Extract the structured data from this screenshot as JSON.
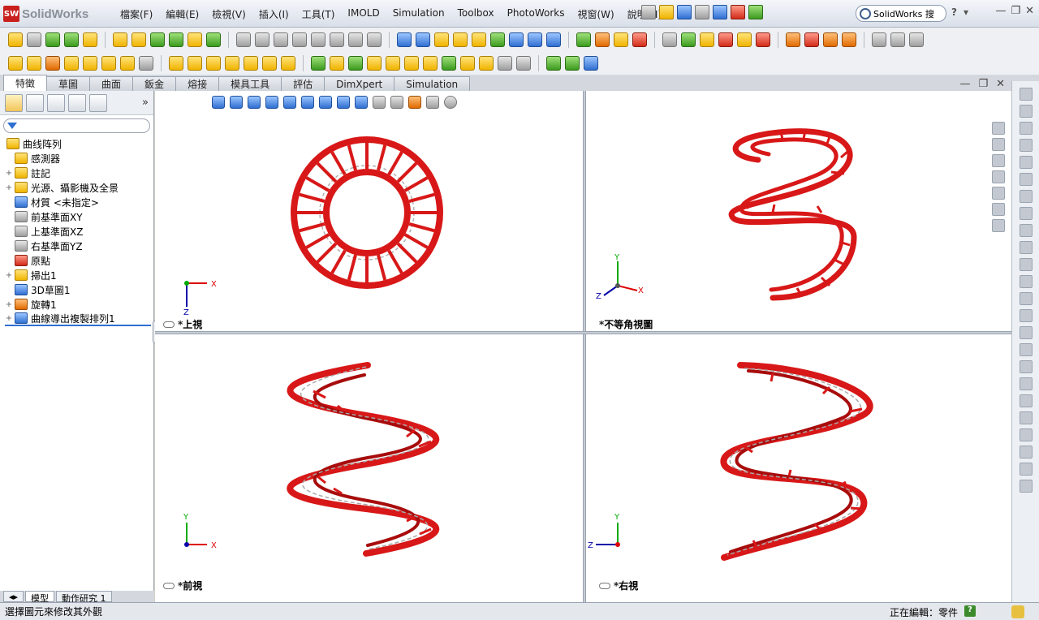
{
  "app": {
    "title": "SolidWorks",
    "logo_mark": "SW"
  },
  "menu": [
    "檔案(F)",
    "編輯(E)",
    "檢視(V)",
    "插入(I)",
    "工具(T)",
    "IMOLD",
    "Simulation",
    "Toolbox",
    "PhotoWorks",
    "視窗(W)",
    "說明(H)"
  ],
  "search": {
    "value": "SolidWorks 搜"
  },
  "help_icons": [
    "?",
    "▾"
  ],
  "window_controls": [
    "—",
    "❐",
    "✕"
  ],
  "command_tabs": [
    "特徵",
    "草圖",
    "曲面",
    "鈑金",
    "熔接",
    "模具工具",
    "評估",
    "DimXpert",
    "Simulation"
  ],
  "active_command_tab": "特徵",
  "feature_tree": {
    "chevron": "»",
    "items": [
      {
        "label": "曲线阵列",
        "expandable": false,
        "root": true,
        "icon": "part-icon"
      },
      {
        "label": "感測器",
        "expandable": false,
        "icon": "sensor-icon"
      },
      {
        "label": "註記",
        "expandable": true,
        "icon": "annotation-icon"
      },
      {
        "label": "光源、攝影機及全景",
        "expandable": true,
        "icon": "lights-icon"
      },
      {
        "label": "材質 <未指定>",
        "expandable": false,
        "icon": "material-icon"
      },
      {
        "label": "前基準面XY",
        "expandable": false,
        "icon": "plane-icon"
      },
      {
        "label": "上基準面XZ",
        "expandable": false,
        "icon": "plane-icon"
      },
      {
        "label": "右基準面YZ",
        "expandable": false,
        "icon": "plane-icon"
      },
      {
        "label": "原點",
        "expandable": false,
        "icon": "origin-icon"
      },
      {
        "label": "掃出1",
        "expandable": true,
        "icon": "sweep-icon"
      },
      {
        "label": "3D草圖1",
        "expandable": false,
        "icon": "sketch3d-icon"
      },
      {
        "label": "旋轉1",
        "expandable": true,
        "icon": "revolve-icon"
      },
      {
        "label": "曲線導出複製排列1",
        "expandable": true,
        "icon": "curve-pattern-icon"
      }
    ]
  },
  "bottom_tabs": [
    "模型",
    "動作研究 1"
  ],
  "viewports": {
    "top": {
      "label": "*上視",
      "axes": [
        "X",
        "Z"
      ]
    },
    "iso": {
      "label": "*不等角視圖",
      "axes": [
        "Y",
        "X",
        "Z"
      ]
    },
    "front": {
      "label": "*前視",
      "axes": [
        "Y",
        "X"
      ]
    },
    "right": {
      "label": "*右視",
      "axes": [
        "Y",
        "Z"
      ]
    }
  },
  "viewport_controls": [
    "—",
    "❐",
    "✕"
  ],
  "model_color": "#d81818",
  "status": {
    "left": "選擇圖元來修改其外觀",
    "right": "正在編輯：零件",
    "help": "?"
  }
}
